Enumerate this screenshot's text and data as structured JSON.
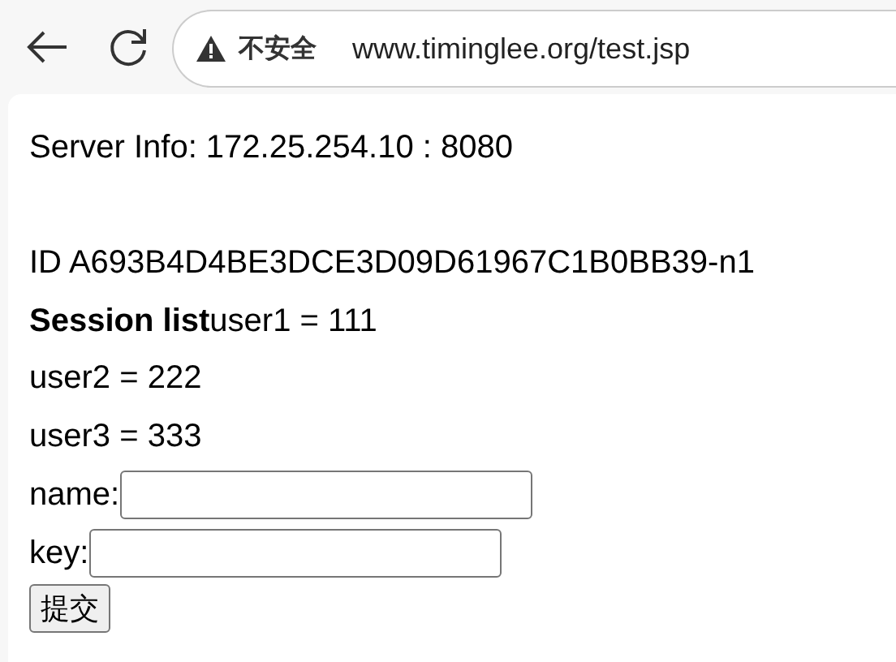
{
  "browser": {
    "security_label": "不安全",
    "url": "www.timinglee.org/test.jsp"
  },
  "page": {
    "server_info": "Server Info: 172.25.254.10 : 8080",
    "session_id": "ID A693B4D4BE3DCE3D09D61967C1B0BB39-n1",
    "session_lines": [
      "**Session list**user1 = 111",
      "user2 = 222",
      "user3 = 333"
    ],
    "fields": [
      {
        "label": "name:"
      },
      {
        "label": "key:"
      }
    ],
    "submit": "提交"
  }
}
